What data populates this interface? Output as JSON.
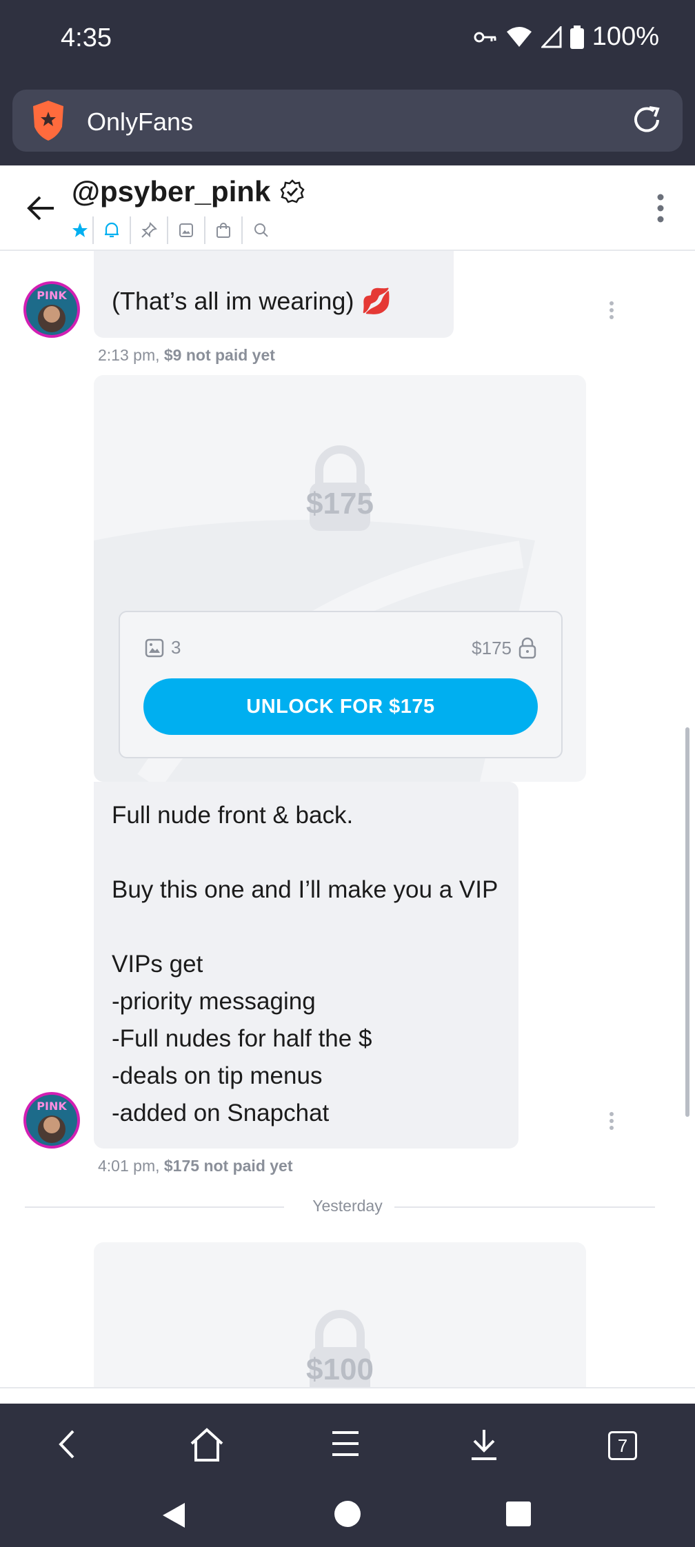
{
  "status_bar": {
    "time": "4:35",
    "battery": "100%"
  },
  "browser": {
    "site_name": "OnlyFans",
    "tabs_count": "7",
    "brand_color": "#ff6b3d"
  },
  "chat_header": {
    "username": "@psyber_pink"
  },
  "messages": [
    {
      "text": "(That’s all im wearing) 💋",
      "time": "2:13 pm,",
      "status": "$9 not paid yet"
    },
    {
      "locked_media": {
        "price": "$175",
        "media_count": "3",
        "price_label": "$175",
        "unlock_label": "UNLOCK FOR $175"
      },
      "text_lines": [
        "Full nude front & back.",
        "",
        "Buy this one and I’ll make you a VIP",
        "",
        "VIPs get",
        "-priority messaging",
        "-Full nudes for half the $",
        "-deals on tip menus",
        "-added on Snapchat"
      ],
      "time": "4:01 pm,",
      "status": "$175 not paid yet"
    },
    {
      "locked_media": {
        "price": "$100"
      }
    }
  ],
  "divider": {
    "label": "Yesterday"
  },
  "accent_color": "#00aff0"
}
